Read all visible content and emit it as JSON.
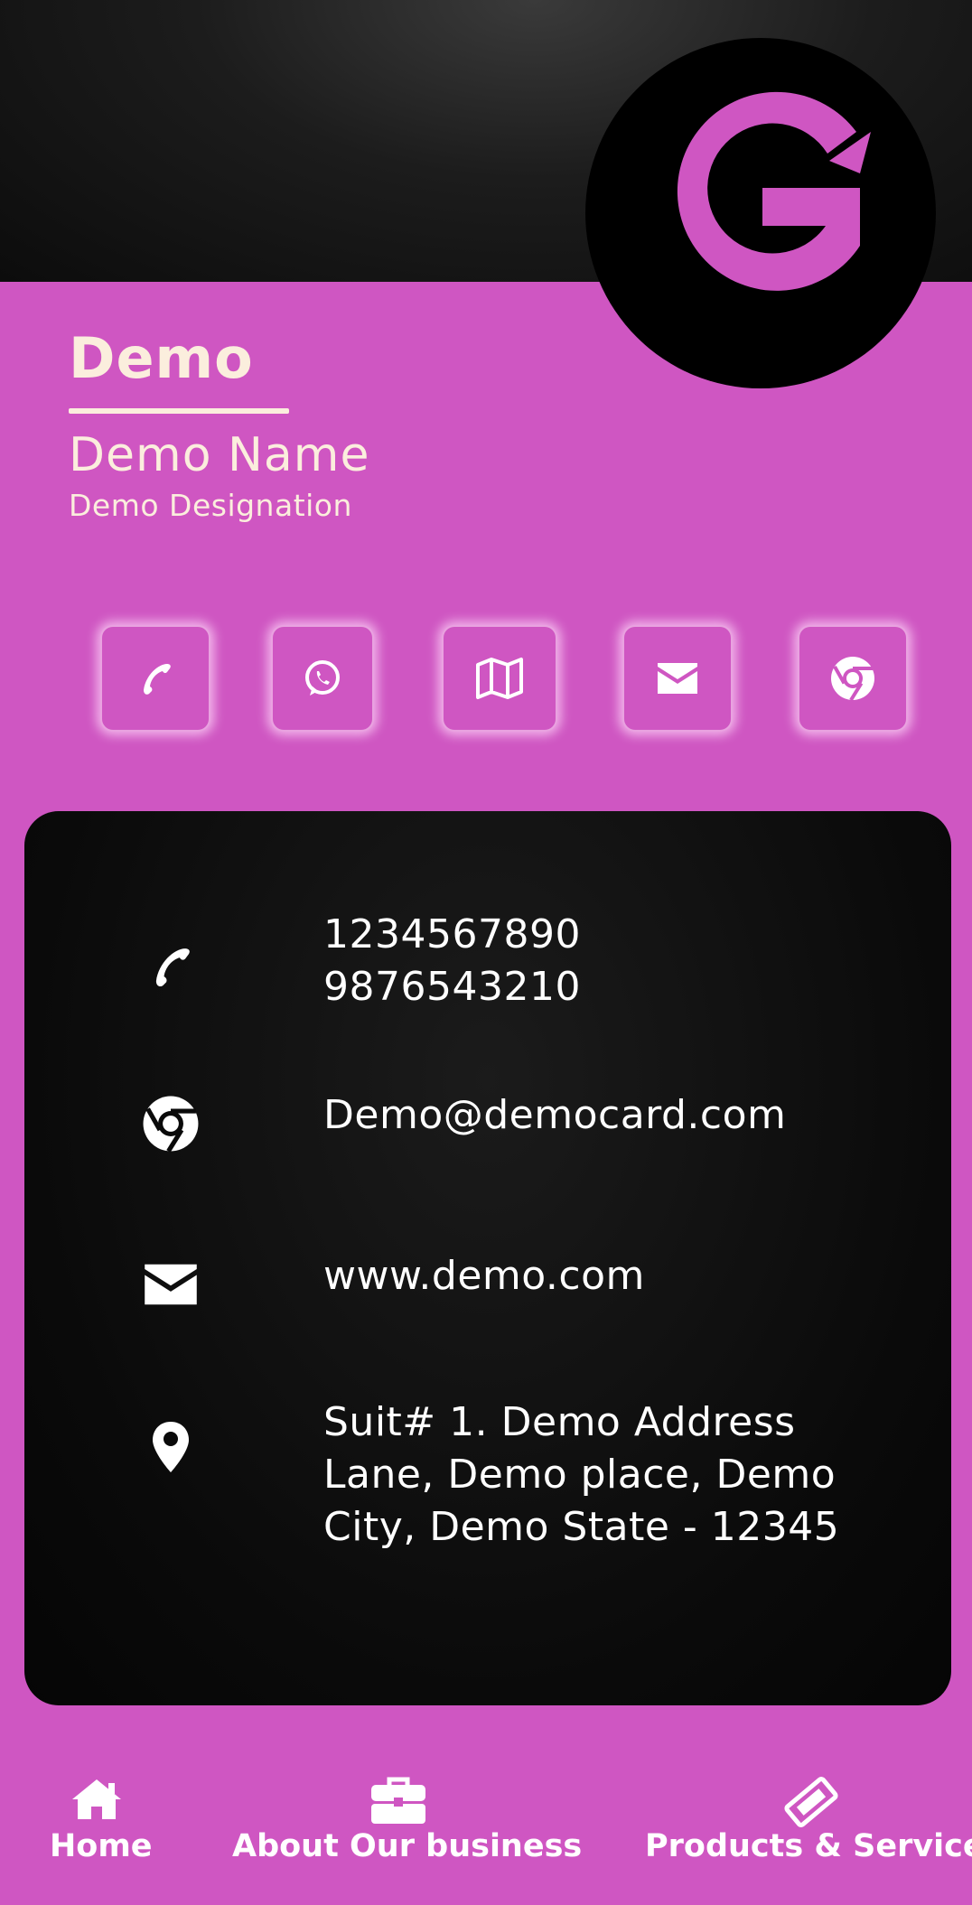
{
  "header": {
    "company": "Demo",
    "name": "Demo Name",
    "designation": "Demo Designation",
    "logo_icon": "g-logo-icon"
  },
  "colors": {
    "brand": "#cf56c2",
    "text_light": "#fbeedd",
    "card_bg": "#0a0a0a"
  },
  "quick_actions": [
    {
      "name": "call",
      "icon": "phone-icon"
    },
    {
      "name": "whatsapp",
      "icon": "whatsapp-icon"
    },
    {
      "name": "map",
      "icon": "map-icon"
    },
    {
      "name": "email",
      "icon": "envelope-icon"
    },
    {
      "name": "website",
      "icon": "chrome-icon"
    }
  ],
  "contact": {
    "phones": [
      "1234567890",
      "9876543210"
    ],
    "email": "Demo@democard.com",
    "website": "www.demo.com",
    "address_lines": [
      "Suit# 1. Demo Address",
      "Lane, Demo place, Demo",
      "City, Demo State - 12345"
    ]
  },
  "nav": {
    "home": "Home",
    "about": "About Our business",
    "products": "Products & Services"
  }
}
